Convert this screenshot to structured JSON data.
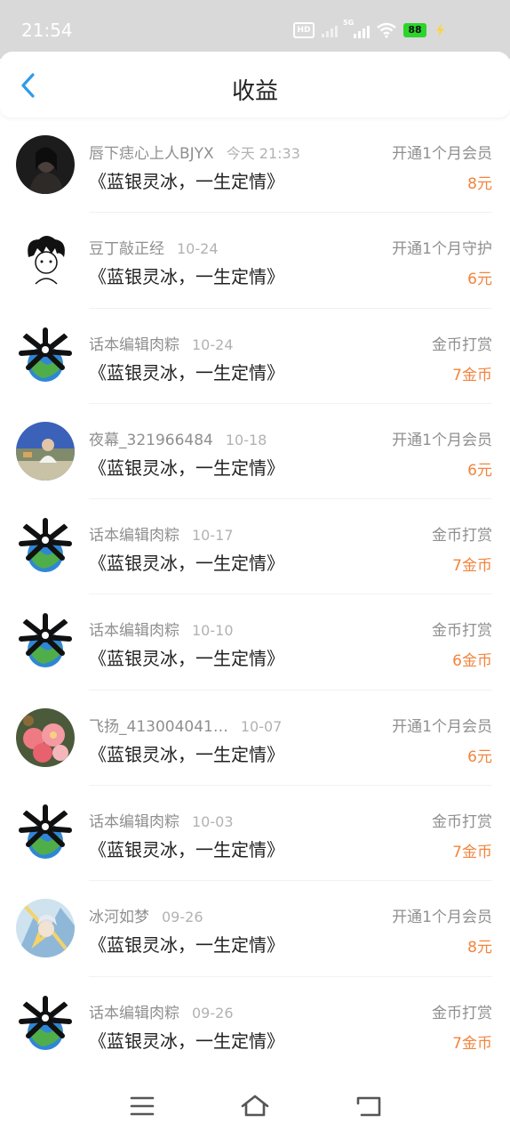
{
  "status_bar": {
    "time": "21:54",
    "hd_label": "HD",
    "signal_label": "5G",
    "battery": "88",
    "icons": [
      "hd-icon",
      "signal-icon",
      "5g-signal-icon",
      "wifi-icon",
      "battery-icon",
      "charging-bolt-icon"
    ]
  },
  "header": {
    "title": "收益",
    "back_icon": "chevron-left-icon"
  },
  "colors": {
    "accent": "#2f9bea",
    "amount": "#f3843d",
    "status_bar_bg": "#d9d9d9"
  },
  "earnings": [
    {
      "user": "唇下痣心上人BJYX",
      "time": "今天 21:33",
      "book": "《蓝银灵冰，一生定情》",
      "type": "开通1个月会员",
      "amount": "8元",
      "avatar": "dark-portrait-avatar"
    },
    {
      "user": "豆丁敲正经",
      "time": "10-24",
      "book": "《蓝银灵冰，一生定情》",
      "type": "开通1个月守护",
      "amount": "6元",
      "avatar": "sketch-avatar"
    },
    {
      "user": "话本编辑肉粽",
      "time": "10-24",
      "book": "《蓝银灵冰，一生定情》",
      "type": "金币打赏",
      "amount": "7金币",
      "avatar": "earth-bones-avatar"
    },
    {
      "user": "夜幕_321966484",
      "time": "10-18",
      "book": "《蓝银灵冰，一生定情》",
      "type": "开通1个月会员",
      "amount": "6元",
      "avatar": "outdoor-photo-avatar"
    },
    {
      "user": "话本编辑肉粽",
      "time": "10-17",
      "book": "《蓝银灵冰，一生定情》",
      "type": "金币打赏",
      "amount": "7金币",
      "avatar": "earth-bones-avatar"
    },
    {
      "user": "话本编辑肉粽",
      "time": "10-10",
      "book": "《蓝银灵冰，一生定情》",
      "type": "金币打赏",
      "amount": "6金币",
      "avatar": "earth-bones-avatar"
    },
    {
      "user": "飞扬_413004041…",
      "time": "10-07",
      "book": "《蓝银灵冰，一生定情》",
      "type": "开通1个月会员",
      "amount": "6元",
      "avatar": "flowers-avatar"
    },
    {
      "user": "话本编辑肉粽",
      "time": "10-03",
      "book": "《蓝银灵冰，一生定情》",
      "type": "金币打赏",
      "amount": "7金币",
      "avatar": "earth-bones-avatar"
    },
    {
      "user": "冰河如梦",
      "time": "09-26",
      "book": "《蓝银灵冰，一生定情》",
      "type": "开通1个月会员",
      "amount": "8元",
      "avatar": "anime-avatar"
    },
    {
      "user": "话本编辑肉粽",
      "time": "09-26",
      "book": "《蓝银灵冰，一生定情》",
      "type": "金币打赏",
      "amount": "7金币",
      "avatar": "earth-bones-avatar"
    }
  ],
  "nav_bar": {
    "items": [
      "menu-icon",
      "home-icon",
      "back-icon"
    ]
  }
}
